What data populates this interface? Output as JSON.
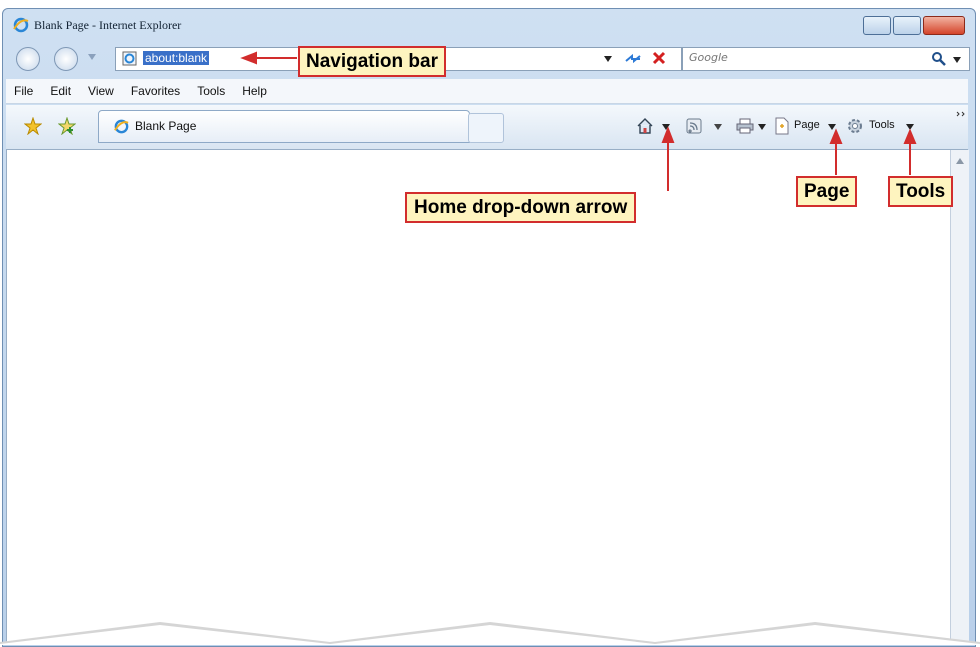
{
  "window": {
    "title": "Blank Page - Internet Explorer"
  },
  "navigation": {
    "address_value": "about:blank",
    "search_placeholder": "Google"
  },
  "menu": [
    "File",
    "Edit",
    "View",
    "Favorites",
    "Tools",
    "Help"
  ],
  "tab": {
    "label": "Blank Page"
  },
  "command_bar": {
    "page_label": "Page",
    "tools_label": "Tools"
  },
  "callouts": {
    "navigation_bar": "Navigation bar",
    "home_dropdown": "Home drop-down arrow",
    "page": "Page",
    "tools": "Tools"
  },
  "colors": {
    "callout_fill": "#fef4bf",
    "callout_border": "#d22d2d",
    "selection": "#3a70c8"
  }
}
